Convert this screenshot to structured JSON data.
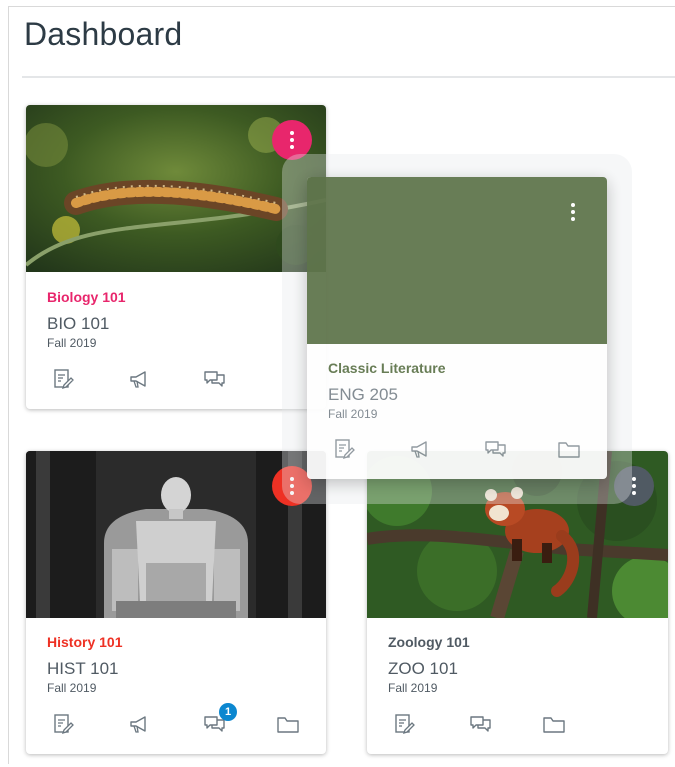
{
  "page": {
    "title": "Dashboard"
  },
  "cards": {
    "biology": {
      "name": "Biology 101",
      "code": "BIO 101",
      "term": "Fall 2019",
      "color": "#e8266c",
      "image": "caterpillar-photo"
    },
    "literature": {
      "name": "Classic Literature",
      "code": "ENG 205",
      "term": "Fall 2019",
      "color": "#5d7349"
    },
    "history": {
      "name": "History 101",
      "code": "HIST 101",
      "term": "Fall 2019",
      "color": "#ee3124",
      "image": "lincoln-memorial-photo",
      "discussions_badge": "1"
    },
    "zoology": {
      "name": "Zoology 101",
      "code": "ZOO 101",
      "term": "Fall 2019",
      "color": "#505a63",
      "image": "red-panda-photo"
    }
  },
  "icons": {
    "assignments": "assignment-icon",
    "announcements": "megaphone-icon",
    "discussions": "discussion-icon",
    "files": "folder-icon",
    "options": "kebab-menu-icon"
  }
}
